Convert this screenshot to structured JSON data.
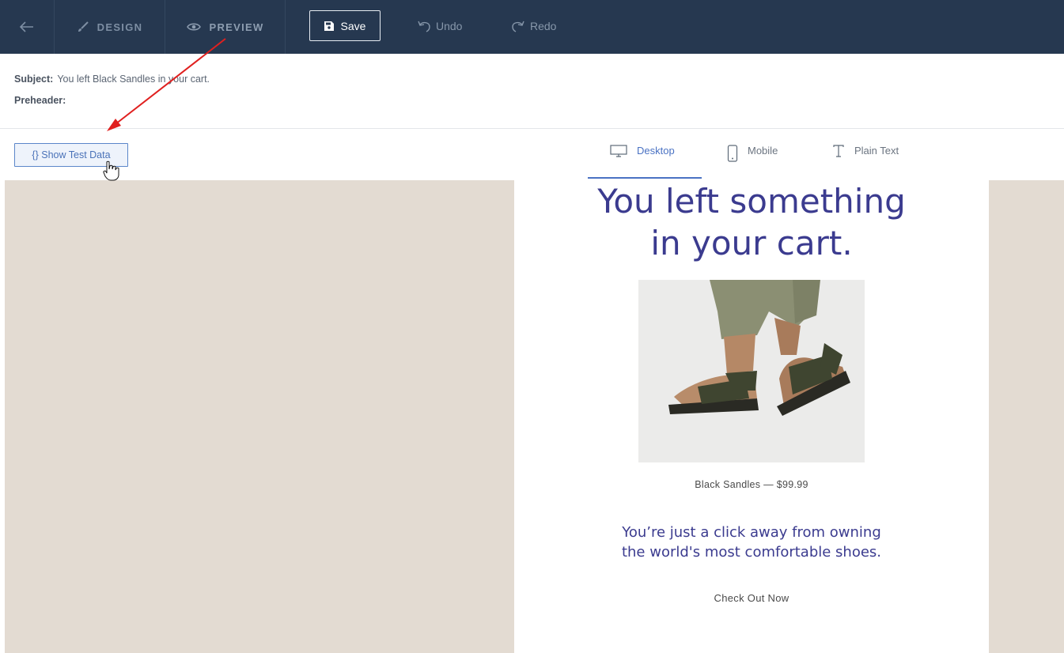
{
  "topbar": {
    "design_label": "DESIGN",
    "preview_label": "PREVIEW",
    "save_label": "Save",
    "undo_label": "Undo",
    "redo_label": "Redo",
    "icons": {
      "back": "arrow-left-icon",
      "design": "brush-icon",
      "preview": "eye-icon",
      "save": "floppy-disk-icon",
      "undo": "undo-icon",
      "redo": "redo-icon"
    }
  },
  "meta": {
    "subject_label": "Subject:",
    "subject_value": "You left Black Sandles in your cart.",
    "preheader_label": "Preheader:",
    "preheader_value": ""
  },
  "toolbar": {
    "test_data_label": "{} Show Test Data",
    "views": [
      {
        "label": "Desktop",
        "icon": "monitor-icon",
        "active": true
      },
      {
        "label": "Mobile",
        "icon": "phone-icon",
        "active": false
      },
      {
        "label": "Plain Text",
        "icon": "text-icon",
        "active": false
      }
    ]
  },
  "email": {
    "headline_line1": "You left something",
    "headline_line2": "in your cart.",
    "product_caption": "Black Sandles — $99.99",
    "body_line1": "You’re just a click away from owning",
    "body_line2": "the world's most comfortable shoes.",
    "cta_label": "Check Out Now"
  },
  "colors": {
    "navbar": "#263850",
    "accent": "#4a72c3",
    "headline": "#3b3b8f",
    "canvas_bg": "#e3dbd2",
    "annotation_arrow": "#e0201f"
  }
}
